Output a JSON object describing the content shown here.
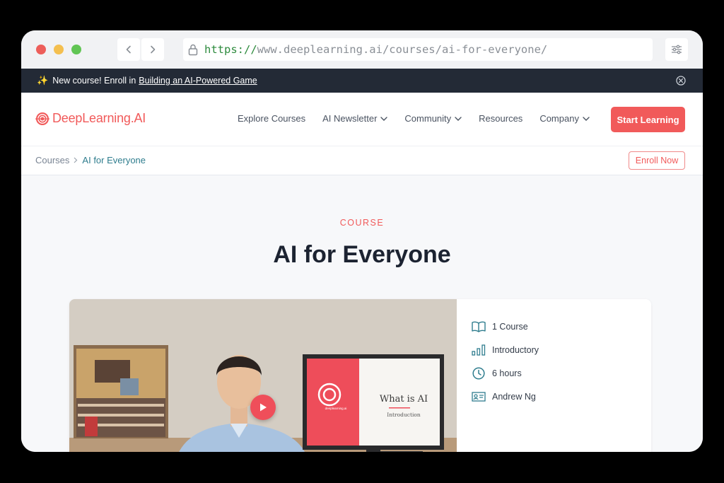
{
  "browser": {
    "url_scheme": "https://",
    "url_rest": "www.deeplearning.ai/courses/ai-for-everyone/"
  },
  "announcement": {
    "prefix": "New course! Enroll in",
    "link": "Building an AI-Powered Game"
  },
  "header": {
    "logo_text": "DeepLearning.AI",
    "nav": {
      "explore": "Explore Courses",
      "newsletter": "AI Newsletter",
      "community": "Community",
      "resources": "Resources",
      "company": "Company"
    },
    "cta": "Start Learning"
  },
  "breadcrumb": {
    "courses": "Courses",
    "current": "AI for Everyone",
    "enroll": "Enroll Now"
  },
  "hero": {
    "eyebrow": "COURSE",
    "title": "AI for Everyone"
  },
  "video": {
    "slide_title": "What is AI",
    "slide_sub": "Introduction",
    "slide_brand": "deeplearning.ai"
  },
  "facts": {
    "courses": "1 Course",
    "level": "Introductory",
    "duration": "6 hours",
    "instructor": "Andrew Ng"
  },
  "colors": {
    "accent": "#f15a5a",
    "teal": "#2f7d8e",
    "dark": "#232a36"
  },
  "icons": {
    "lock": "lock-icon",
    "back": "chevron-left-icon",
    "forward": "chevron-right-icon",
    "tune": "sliders-icon",
    "close": "close-circle-icon",
    "play": "play-icon",
    "book": "book-icon",
    "level": "bar-chart-icon",
    "clock": "clock-icon",
    "instructor": "id-card-icon"
  }
}
